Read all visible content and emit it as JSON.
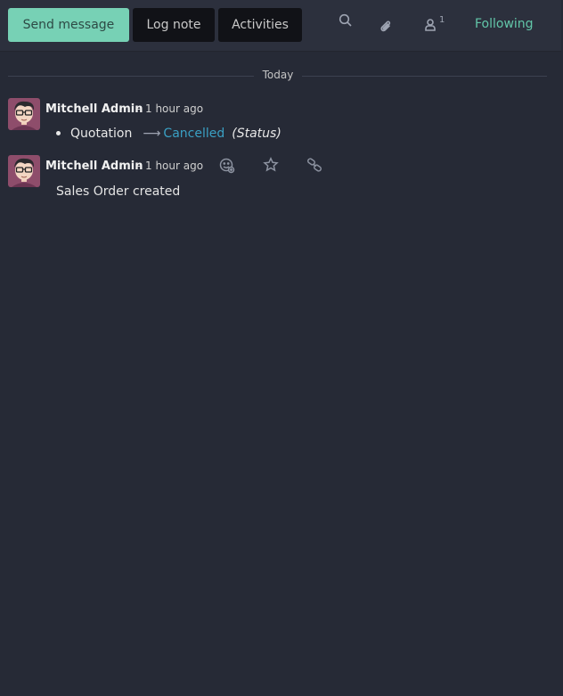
{
  "composer": {
    "send_message": "Send message",
    "log_note": "Log note",
    "activities": "Activities"
  },
  "topbar": {
    "search_icon": "search-icon",
    "attachment_icon": "paperclip-icon",
    "followers_icon": "user-icon",
    "followers_count": "1",
    "following_label": "Following"
  },
  "thread": {
    "date_separator": "Today",
    "messages": [
      {
        "author": "Mitchell Admin",
        "separator": "-",
        "time": "1 hour ago",
        "tracking": {
          "old_value": "Quotation",
          "new_value": "Cancelled",
          "field": "(Status)"
        }
      },
      {
        "author": "Mitchell Admin",
        "separator": "-",
        "time": "1 hour ago",
        "body": "Sales Order created",
        "actions": [
          "add-reaction-icon",
          "star-icon",
          "link-icon"
        ]
      }
    ]
  },
  "colors": {
    "background": "#262a36",
    "primary": "#77d1b5",
    "following": "#62c6a9",
    "tracking_new": "#3aa0c4"
  }
}
